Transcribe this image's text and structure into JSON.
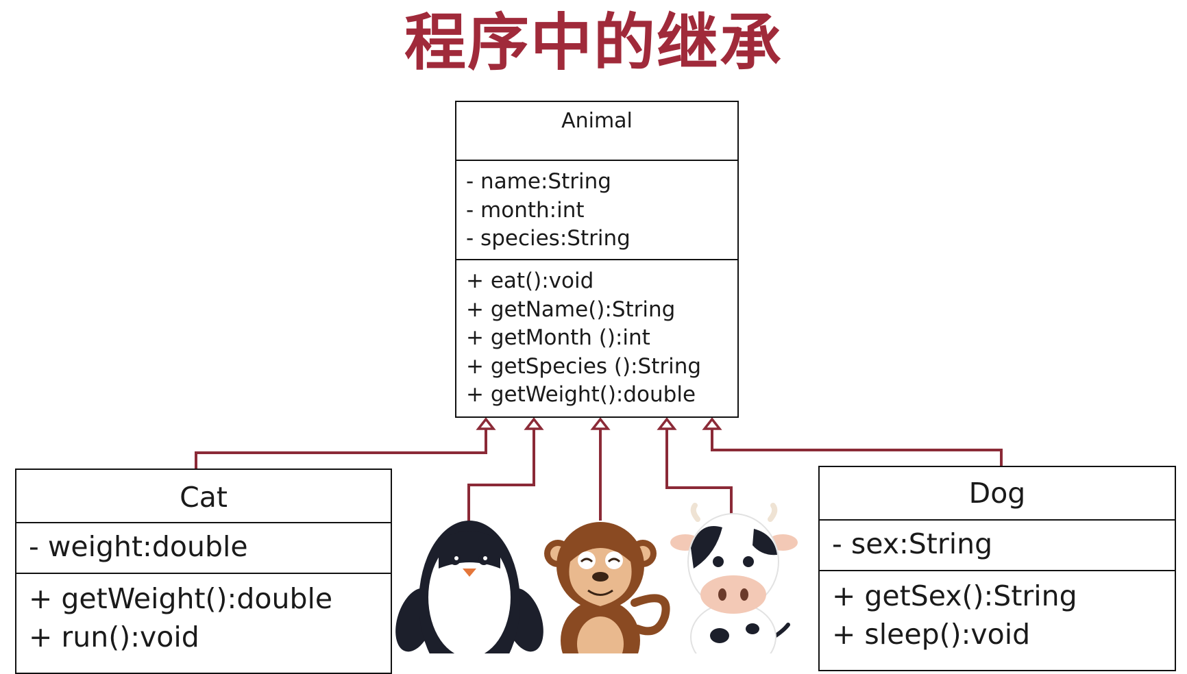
{
  "title": "程序中的继承",
  "colors": {
    "accent": "#a02a3a",
    "connector": "#8b2a37",
    "border": "#111111"
  },
  "classes": {
    "animal": {
      "name": "Animal",
      "attributes": [
        "- name:String",
        "- month:int",
        "- species:String"
      ],
      "methods": [
        "+ eat():void",
        "+ getName():String",
        "+ getMonth ():int",
        "+ getSpecies ():String",
        "+ getWeight():double"
      ]
    },
    "cat": {
      "name": "Cat",
      "attributes": [
        "- weight:double"
      ],
      "methods": [
        "+ getWeight():double",
        "+ run():void"
      ]
    },
    "dog": {
      "name": "Dog",
      "attributes": [
        "- sex:String"
      ],
      "methods": [
        "+ getSex():String",
        "+ sleep():void"
      ]
    }
  },
  "illustrations": [
    "penguin",
    "monkey",
    "cow"
  ]
}
